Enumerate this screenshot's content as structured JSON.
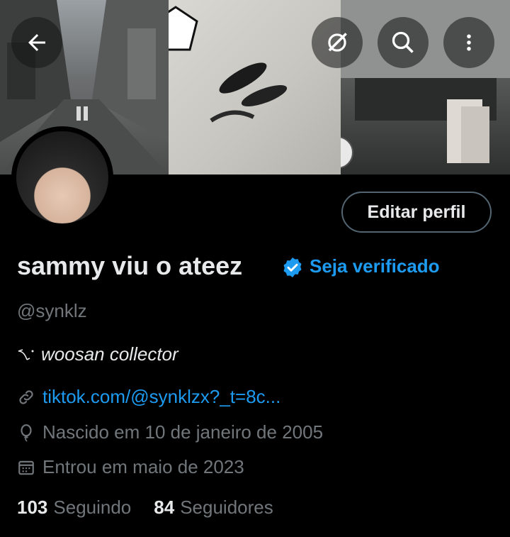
{
  "profile": {
    "display_name": "sammy viu o ateez",
    "verify_cta": "Seja verificado",
    "handle": "@synklz",
    "bio": "woosan collector",
    "link": "tiktok.com/@synklzx?_t=8c...",
    "birthday": "Nascido em 10 de janeiro de 2005",
    "joined": "Entrou em maio de 2023"
  },
  "stats": {
    "following_count": "103",
    "following_label": "Seguindo",
    "followers_count": "84",
    "followers_label": "Seguidores"
  },
  "actions": {
    "edit_profile": "Editar perfil"
  },
  "icons": [
    "back-arrow-icon",
    "grok-icon",
    "search-icon",
    "more-vertical-icon",
    "verified-badge-icon",
    "link-icon",
    "balloon-icon",
    "calendar-icon"
  ],
  "colors": {
    "background": "#000000",
    "accent": "#1d9bf0",
    "muted": "#71767b",
    "text": "#e7e9ea"
  }
}
